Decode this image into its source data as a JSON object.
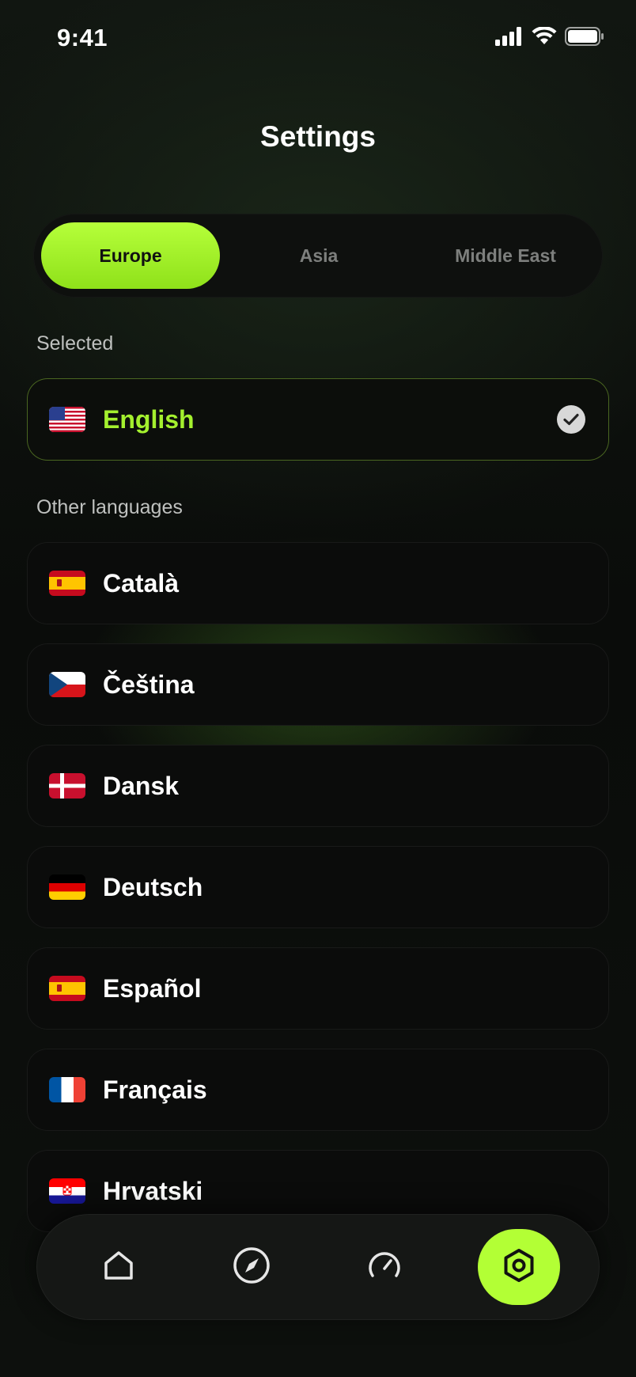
{
  "status": {
    "time": "9:41"
  },
  "header": {
    "title": "Settings"
  },
  "regions": [
    {
      "label": "Europe",
      "active": true
    },
    {
      "label": "Asia",
      "active": false
    },
    {
      "label": "Middle East",
      "active": false
    }
  ],
  "sections": {
    "selected_label": "Selected",
    "other_label": "Other languages"
  },
  "selected_language": {
    "label": "English",
    "flag": "us-flag-icon"
  },
  "other_languages": [
    {
      "label": "Català",
      "flag": "spain-flag-icon"
    },
    {
      "label": "Čeština",
      "flag": "czech-flag-icon"
    },
    {
      "label": "Dansk",
      "flag": "denmark-flag-icon"
    },
    {
      "label": "Deutsch",
      "flag": "germany-flag-icon"
    },
    {
      "label": "Español",
      "flag": "spain-flag-icon"
    },
    {
      "label": "Français",
      "flag": "france-flag-icon"
    },
    {
      "label": "Hrvatski",
      "flag": "croatia-flag-icon"
    }
  ],
  "tabbar": {
    "items": [
      {
        "icon": "home-icon",
        "active": false
      },
      {
        "icon": "compass-icon",
        "active": false
      },
      {
        "icon": "speedometer-icon",
        "active": false
      },
      {
        "icon": "settings-hexagon-icon",
        "active": true
      }
    ]
  },
  "colors": {
    "accent": "#b3ff35",
    "selected_text": "#a4f02e",
    "background": "#0a0c0a"
  }
}
